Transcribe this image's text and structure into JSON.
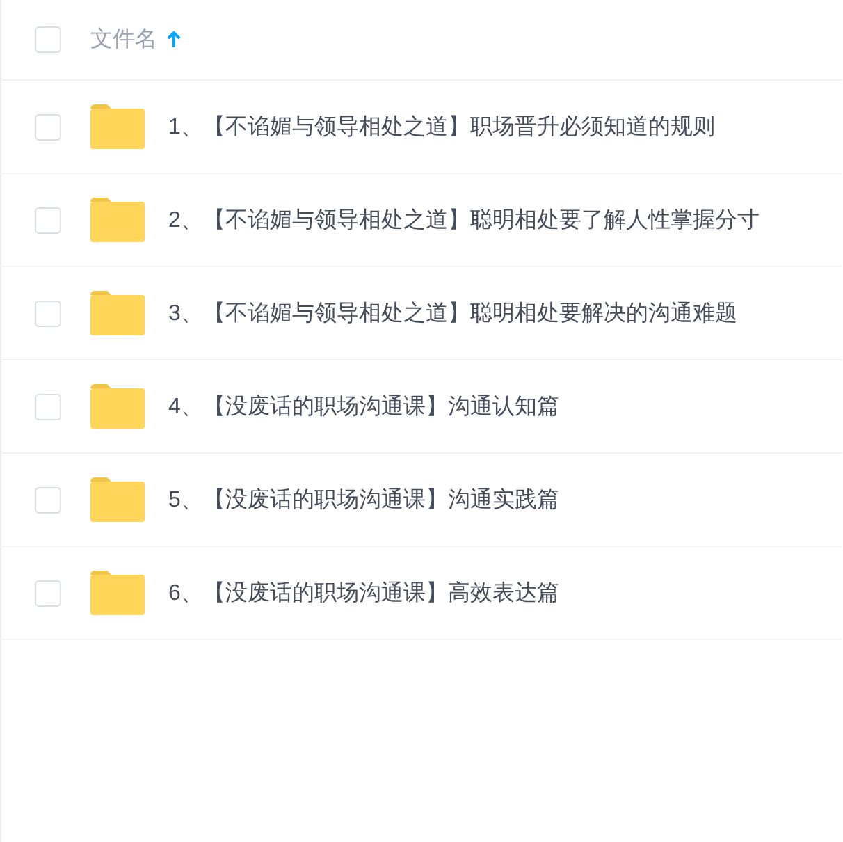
{
  "header": {
    "checked": false,
    "column": "文件名",
    "sort_ascending": true
  },
  "rows": [
    {
      "name": "1、【不谄媚与领导相处之道】职场晋升必须知道的规则",
      "checked": false
    },
    {
      "name": "2、【不谄媚与领导相处之道】聪明相处要了解人性掌握分寸",
      "checked": false
    },
    {
      "name": "3、【不谄媚与领导相处之道】聪明相处要解决的沟通难题",
      "checked": false
    },
    {
      "name": "4、【没废话的职场沟通课】沟通认知篇",
      "checked": false
    },
    {
      "name": "5、【没废话的职场沟通课】沟通实践篇",
      "checked": false
    },
    {
      "name": "6、【没废话的职场沟通课】高效表达篇",
      "checked": false
    }
  ]
}
